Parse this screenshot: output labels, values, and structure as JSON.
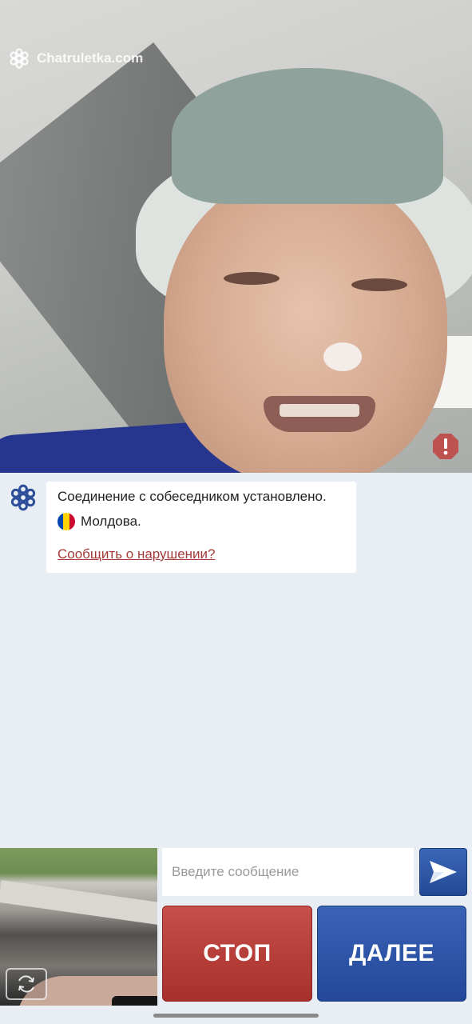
{
  "watermark": {
    "text": "Chatruletka.com",
    "icon": "logo-flower-icon"
  },
  "remote_video": {
    "report_icon": "alert-octagon-icon"
  },
  "chat": {
    "message": {
      "status": "Соединение с собеседником установлено.",
      "country": "Молдова.",
      "country_flag_icon": "flag-moldova-icon",
      "report_link": "Сообщить о нарушении?"
    }
  },
  "composer": {
    "placeholder": "Введите сообщение",
    "send_icon": "send-arrow-icon"
  },
  "controls": {
    "stop_label": "СТОП",
    "next_label": "ДАЛЕЕ",
    "camera_switch_icon": "camera-switch-icon"
  },
  "colors": {
    "stop": "#b5403b",
    "next": "#2e55a8",
    "background": "#e8eef3",
    "link": "#a33a36"
  }
}
